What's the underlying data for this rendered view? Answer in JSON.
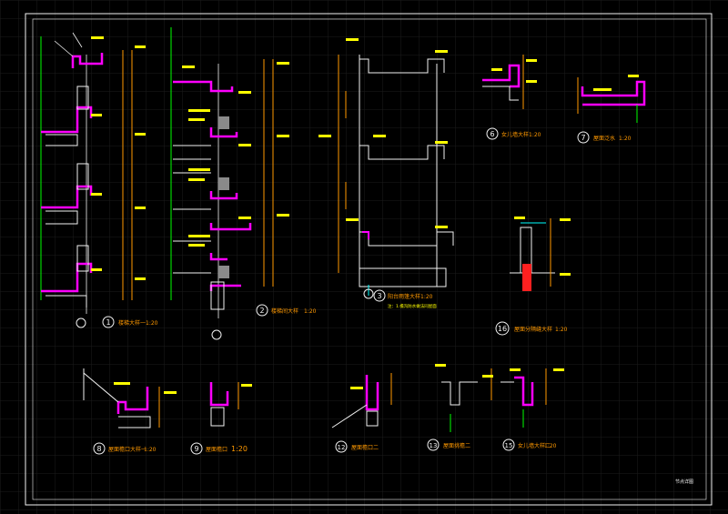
{
  "drawing": {
    "background": "#000000",
    "grid_color": "#1e1e1e",
    "colors": {
      "white": "#f2f2f2",
      "magenta": "#ff00ff",
      "yellow": "#ffff00",
      "orange": "#ff9900",
      "green": "#00ff00",
      "cyan": "#00ffff",
      "red": "#ff2020",
      "gray": "#8a8a8a"
    },
    "details": [
      {
        "num": "1",
        "title": "楼梯大样一",
        "scale": "1:20"
      },
      {
        "num": "2",
        "title": "楼梯间大样",
        "scale": "1:20"
      },
      {
        "num": "3",
        "title": "阳台雨篷大样",
        "scale": "1:20"
      },
      {
        "num": "6",
        "title": "女儿墙大样",
        "scale": "1:20"
      },
      {
        "num": "7",
        "title": "屋面泛水",
        "scale": "1:20"
      },
      {
        "num": "16",
        "title": "屋面分隔缝大样",
        "scale": "1:20"
      },
      {
        "num": "8",
        "title": "屋面檐口大样一",
        "scale": "1:20"
      },
      {
        "num": "9",
        "title": "屋面檐口",
        "scale": "1:20"
      },
      {
        "num": "12",
        "title": "屋面檐口二",
        "scale": ""
      },
      {
        "num": "13",
        "title": "屋面挑檐二",
        "scale": ""
      },
      {
        "num": "15",
        "title": "女儿墙大样二",
        "scale": "1:20"
      }
    ],
    "note_3": "注：1.檐沟防水做法同屋面",
    "stamp": "节点详图"
  }
}
